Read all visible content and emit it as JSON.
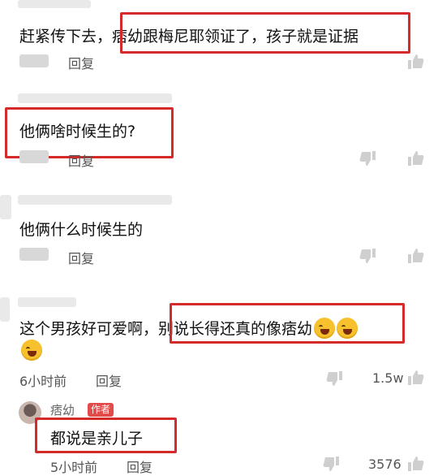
{
  "comments": [
    {
      "text_prefix": "赶紧传下去，",
      "text_highlight": "痞幼跟梅尼耶领证了，孩子就是证据",
      "reply_label": "回复"
    },
    {
      "text": "他俩啥时候生的?",
      "reply_label": "回复"
    },
    {
      "text": "他俩什么时候生的",
      "reply_label": "回复"
    },
    {
      "text_prefix": "这个男孩好可爱啊，",
      "text_highlight": "别说长得还真的像痞幼",
      "emoji": "rolling-on-floor-laughing",
      "time": "6小时前",
      "reply_label": "回复",
      "likes": "1.5w"
    }
  ],
  "author_reply": {
    "username": "痞幼",
    "badge": "作者",
    "text": "都说是亲儿子",
    "time": "5小时前",
    "reply_label": "回复",
    "likes": "3576"
  },
  "colors": {
    "highlight_box": "#d42a2a",
    "author_badge": "#e34a4a"
  }
}
